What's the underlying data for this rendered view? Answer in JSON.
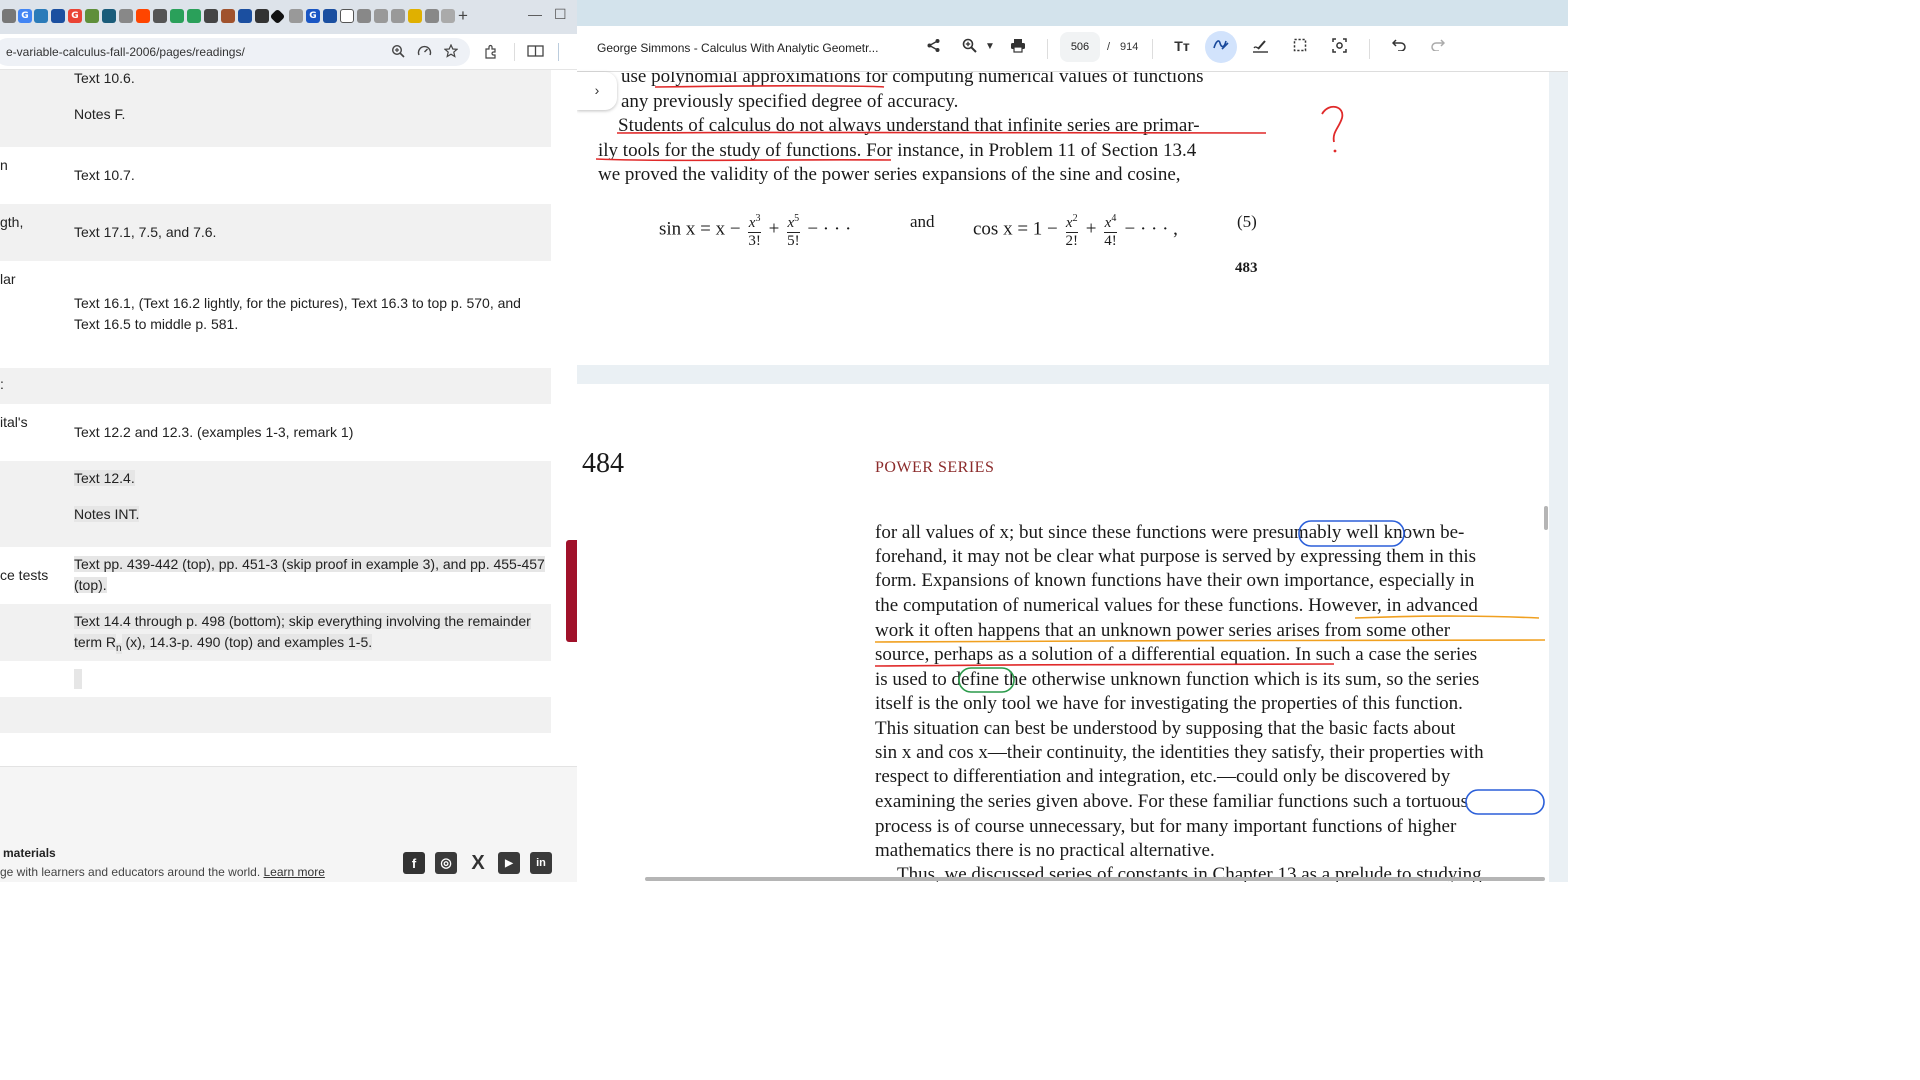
{
  "browser": {
    "url": "e-variable-calculus-fall-2006/pages/readings/",
    "new_tab": "+",
    "minimize": "—",
    "maximize": "☐",
    "rows": [
      {
        "label": "",
        "texts": [
          "Text 10.6.",
          "Notes F."
        ]
      },
      {
        "label": "n",
        "texts": [
          "Text 10.7."
        ]
      },
      {
        "label": "gth,",
        "texts": [
          "Text 17.1, 7.5, and 7.6."
        ]
      },
      {
        "label": "lar",
        "texts": [
          "Text 16.1, (Text 16.2 lightly, for the pictures), Text 16.3 to top p. 570, and Text 16.5 to middle p. 581."
        ]
      },
      {
        "label": "",
        "texts": []
      },
      {
        "label": "ital's",
        "texts": [
          "Text 12.2 and 12.3. (examples 1-3, remark 1)"
        ]
      },
      {
        "label": "",
        "texts": [
          "Text 12.4.",
          "Notes INT."
        ]
      },
      {
        "label": "ce tests",
        "texts": [
          "Text pp. 439-442 (top), pp. 451-3 (skip proof in example 3), and pp. 455-457 (top)."
        ]
      },
      {
        "label": "",
        "texts": [
          "Text 14.4 through p. 498 (bottom); skip everything involving the remainder term R",
          "n",
          " (x), 14.3-p. 490 (top) and examples 1-5."
        ]
      }
    ],
    "footer": {
      "heading": "materials",
      "text": "ge with learners and educators around the world.",
      "link": "Learn more",
      "social": [
        "f",
        "◎",
        "X",
        "▶",
        "in"
      ]
    }
  },
  "pdf": {
    "title": "George Simmons - Calculus With Analytic Geometr...",
    "current_page": "506",
    "separator": "/",
    "total_pages": "914",
    "sidebar_toggle": "›",
    "page1": {
      "lines": [
        "use polynomial approximations for computing numerical values of functions",
        "any previously specified degree of accuracy.",
        "Students of calculus do not always understand that infinite series are primar-",
        "ily tools for the study of functions. For instance, in Problem 11 of Section 13.4",
        "we proved the validity of the power series expansions of the sine and cosine,"
      ],
      "eq_sin": "sin x = x −",
      "eq_and": "and",
      "eq_cos": "cos x = 1 −",
      "eq_num": "(5)",
      "page_number": "483",
      "annotation_mark": "?"
    },
    "page2": {
      "page_number": "484",
      "chapter_title": "POWER SERIES",
      "lines": [
        "for all values of x; but since these functions were presumably well known be-",
        "forehand, it may not be clear what purpose is served by expressing them in this",
        "form. Expansions of known functions have their own importance, especially in",
        "the computation of numerical values for these functions. However, in advanced",
        "work it often happens that an unknown power series arises from some other",
        "source, perhaps as a solution of a differential equation. In such a case the series",
        "is used to define the otherwise unknown function which is its sum, so the series",
        "itself is the only tool we have for investigating the properties of this function.",
        "This situation can best be understood by supposing that the basic facts about",
        "sin x and cos x—their continuity, the identities they satisfy, their properties with",
        "respect to differentiation and integration, etc.—could only be discovered by",
        "examining the series given above. For these familiar functions such a tortuous",
        "process is of course unnecessary, but for many important functions of higher",
        "mathematics there is no practical alternative.",
        "Thus, we discussed series of constants in Chapter 13 as a prelude to studying"
      ]
    }
  },
  "colors": {
    "red_ink": "#e02a2a",
    "blue_ink": "#2b5fd9",
    "green_ink": "#2a9a4a",
    "orange_ink": "#f0a020",
    "chapter": "#8b2a2a"
  }
}
